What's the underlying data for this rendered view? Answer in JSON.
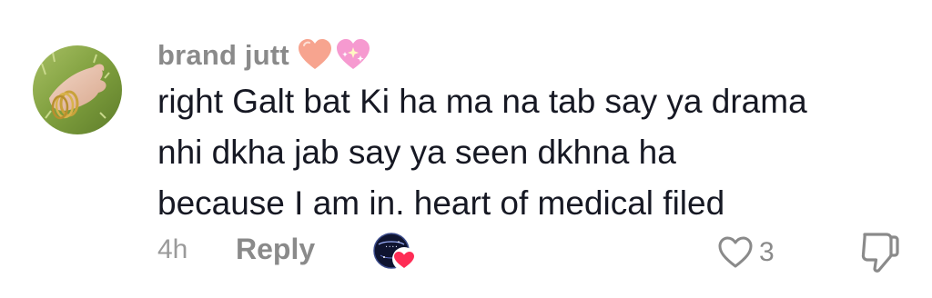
{
  "comment": {
    "author": "brand jutt",
    "author_emojis": [
      "peach-heart-icon",
      "sparkling-heart-icon"
    ],
    "lines": [
      "right Galt bat Ki ha ma na tab say ya drama",
      "nhi dkha jab say ya seen dkhna ha",
      "because I am in. heart of medical filed"
    ],
    "time": "4h",
    "reply_label": "Reply",
    "like_count": "3"
  },
  "colors": {
    "text": "#161823",
    "muted": "#8a8a8a",
    "heart_red": "#fe2c55"
  }
}
